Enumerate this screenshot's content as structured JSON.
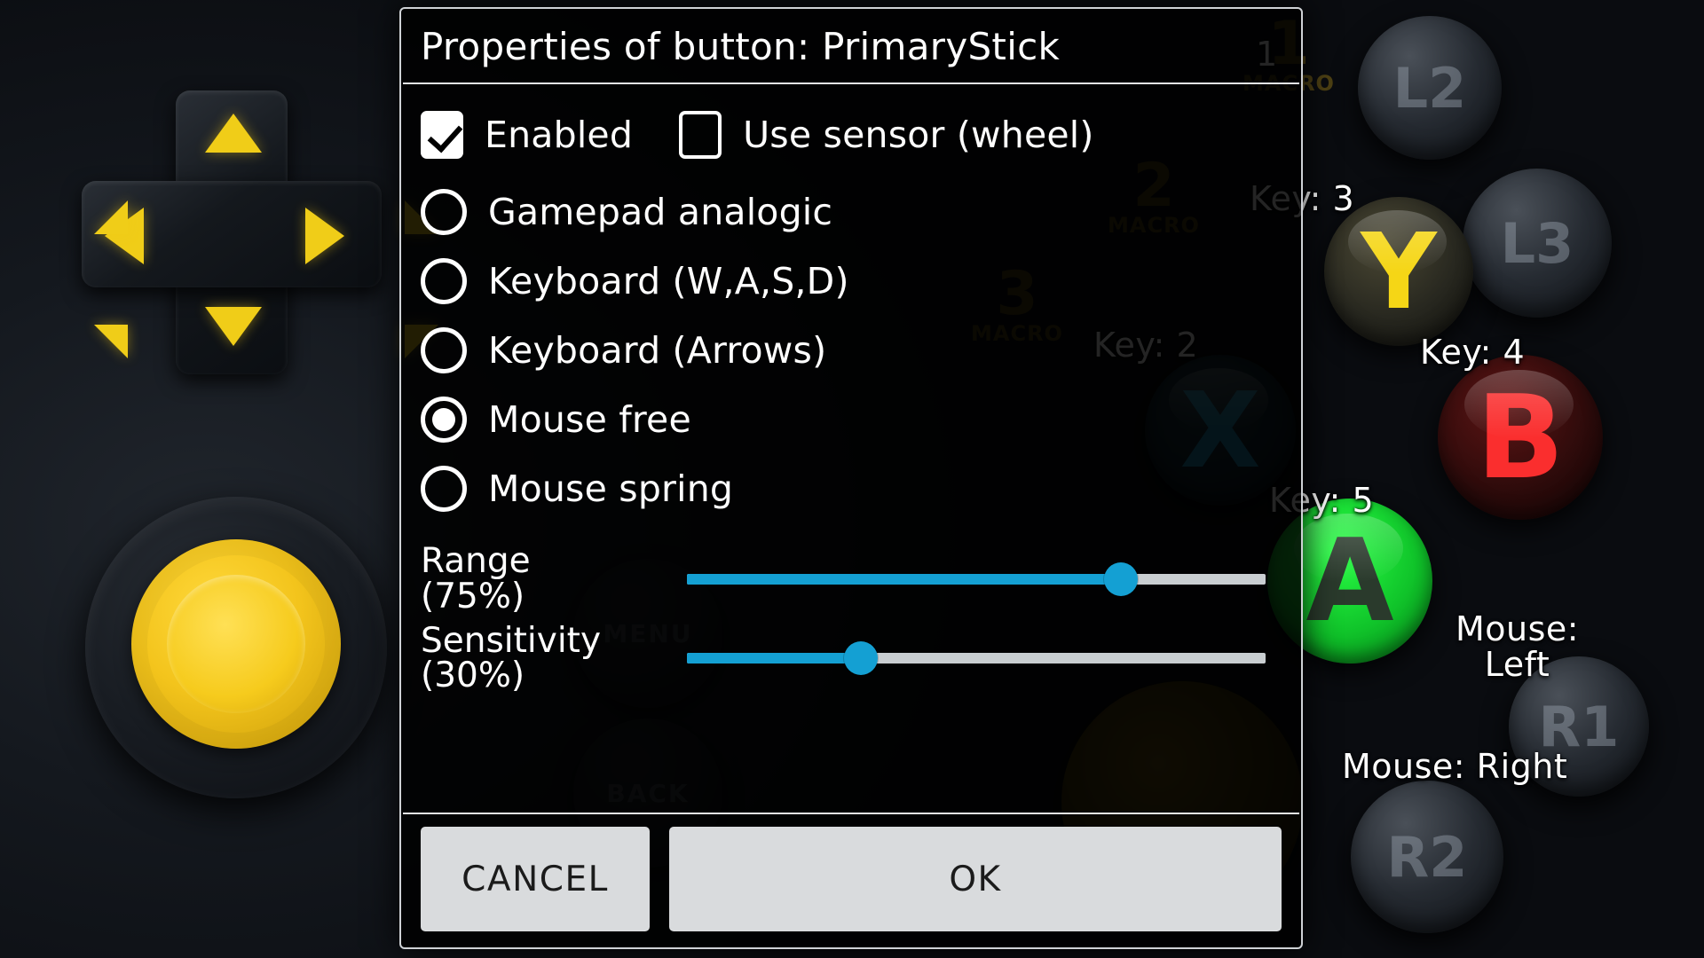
{
  "dialog": {
    "title": "Properties of button: PrimaryStick",
    "checkboxes": [
      {
        "label": "Enabled",
        "checked": true,
        "name": "enabled"
      },
      {
        "label": "Use sensor (wheel)",
        "checked": false,
        "name": "use-sensor-wheel"
      }
    ],
    "radio_group_name": "stick-mode",
    "radios": [
      {
        "label": "Gamepad analogic",
        "selected": false
      },
      {
        "label": "Keyboard (W,A,S,D)",
        "selected": false
      },
      {
        "label": "Keyboard (Arrows)",
        "selected": false
      },
      {
        "label": "Mouse free",
        "selected": true
      },
      {
        "label": "Mouse spring",
        "selected": false
      }
    ],
    "sliders": [
      {
        "name": "range",
        "label": "Range\n(75%)",
        "value": 75,
        "min": 0,
        "max": 100,
        "unit": "%"
      },
      {
        "name": "sensitivity",
        "label": "Sensitivity\n(30%)",
        "value": 30,
        "min": 0,
        "max": 100,
        "unit": "%"
      }
    ],
    "buttons": {
      "cancel": "CANCEL",
      "ok": "OK"
    },
    "colors": {
      "slider_fill": "#14a0d3",
      "slider_track": "#c9ced1",
      "button_bg": "#d9dbdd",
      "border": "#cfd2d6"
    }
  },
  "background": {
    "overlay_labels": [
      {
        "name": "key-1",
        "text": "1"
      },
      {
        "name": "key-2",
        "text": "Key: 2"
      },
      {
        "name": "key-3",
        "text": "Key: 3"
      },
      {
        "name": "key-4",
        "text": "Key: 4"
      },
      {
        "name": "key-5",
        "text": "Key: 5"
      },
      {
        "name": "mouse-left",
        "text": "Mouse:\nLeft"
      },
      {
        "name": "mouse-right",
        "text": "Mouse: Right"
      }
    ],
    "macros": [
      {
        "num": "1",
        "label": "MACRO"
      },
      {
        "num": "2",
        "label": "MACRO"
      },
      {
        "num": "3",
        "label": "MACRO"
      }
    ],
    "face_buttons": [
      {
        "name": "y",
        "glyph": "Y"
      },
      {
        "name": "b",
        "glyph": "B"
      },
      {
        "name": "a",
        "glyph": "A"
      },
      {
        "name": "x",
        "glyph": "X"
      }
    ],
    "shoulder_buttons": [
      {
        "name": "l2",
        "glyph": "L2"
      },
      {
        "name": "l3",
        "glyph": "L3"
      },
      {
        "name": "r1",
        "glyph": "R1"
      },
      {
        "name": "r2",
        "glyph": "R2"
      }
    ],
    "system_buttons": [
      {
        "name": "menu",
        "glyph": "MENU"
      },
      {
        "name": "back",
        "glyph": "BACK"
      }
    ]
  }
}
